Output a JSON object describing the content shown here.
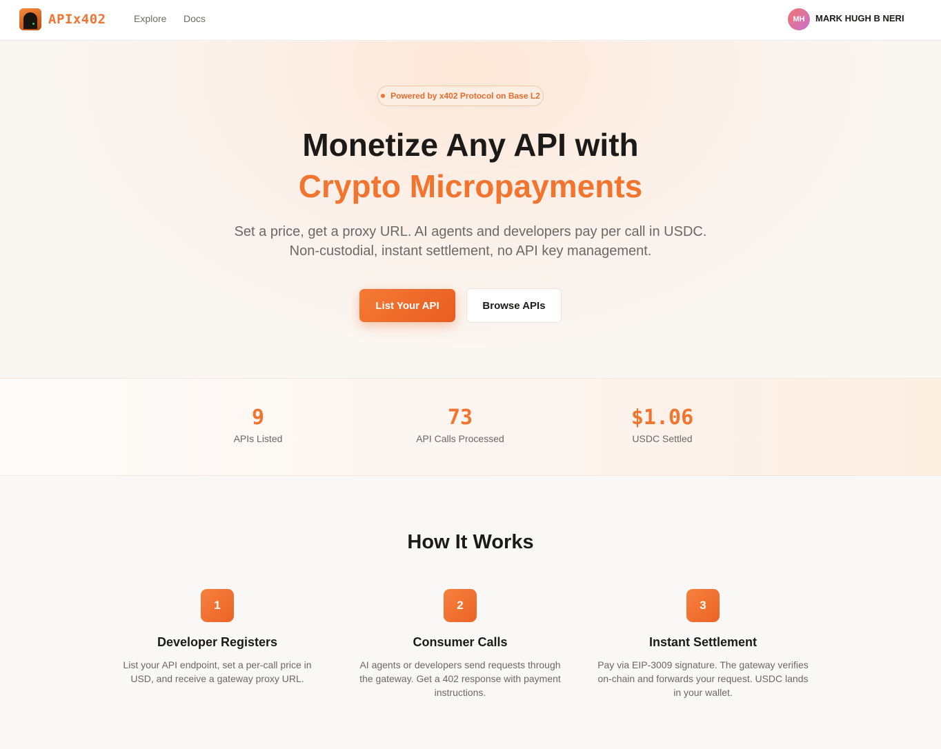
{
  "header": {
    "logo_text": "APIx402",
    "nav": [
      {
        "label": "Explore"
      },
      {
        "label": "Docs"
      }
    ],
    "user": {
      "initials": "MH",
      "name": "MARK HUGH B NERI"
    }
  },
  "hero": {
    "badge": "Powered by x402 Protocol on Base L2",
    "title_line1": "Monetize Any API with",
    "title_line2": "Crypto Micropayments",
    "subtitle": "Set a price, get a proxy URL. AI agents and developers pay per call in USDC. Non-custodial, instant settlement, no API key management.",
    "primary_button": "List Your API",
    "secondary_button": "Browse APIs"
  },
  "stats": [
    {
      "value": "9",
      "label": "APIs Listed"
    },
    {
      "value": "73",
      "label": "API Calls Processed"
    },
    {
      "value": "$1.06",
      "label": "USDC Settled"
    }
  ],
  "how_it_works": {
    "title": "How It Works",
    "steps": [
      {
        "number": "1",
        "title": "Developer Registers",
        "description": "List your API endpoint, set a per-call price in USD, and receive a gateway proxy URL."
      },
      {
        "number": "2",
        "title": "Consumer Calls",
        "description": "AI agents or developers send requests through the gateway. Get a 402 response with payment instructions."
      },
      {
        "number": "3",
        "title": "Instant Settlement",
        "description": "Pay via EIP-3009 signature. The gateway verifies on-chain and forwards your request. USDC lands in your wallet."
      }
    ]
  },
  "colors": {
    "accent": "#f2742f",
    "text": "#1c1a19",
    "muted": "#6d6763"
  }
}
